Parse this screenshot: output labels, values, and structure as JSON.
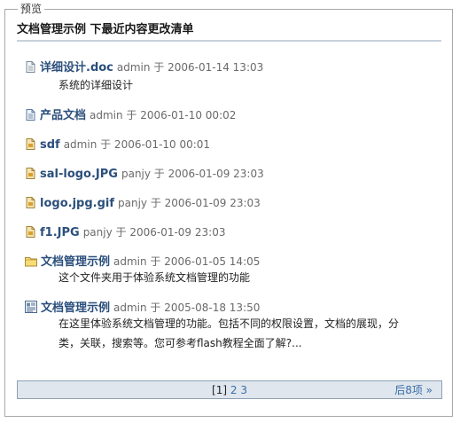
{
  "panel": {
    "legend": "预览"
  },
  "header": {
    "title": "文档管理示例 下最近内容更改清单"
  },
  "items": [
    {
      "icon": "document-icon",
      "name": "详细设计.doc",
      "meta": "admin 于 2006-01-14 13:03",
      "desc": "系统的详细设计"
    },
    {
      "icon": "document-icon",
      "name": "产品文档",
      "meta": "admin 于 2006-01-10 00:02"
    },
    {
      "icon": "image-file-icon",
      "name": "sdf",
      "meta": "admin 于 2006-01-10 00:01"
    },
    {
      "icon": "image-file-icon",
      "name": "sal-logo.JPG",
      "meta": "panjy 于 2006-01-09 23:03"
    },
    {
      "icon": "image-file-icon",
      "name": "logo.jpg.gif",
      "meta": "panjy 于 2006-01-09 23:03"
    },
    {
      "icon": "image-file-icon",
      "name": "f1.JPG",
      "meta": "panjy 于 2006-01-09 23:03"
    },
    {
      "icon": "folder-icon",
      "name": "文档管理示例",
      "meta": "admin 于 2006-01-05 14:05",
      "desc": "这个文件夹用于体验系统文档管理的功能"
    },
    {
      "icon": "news-document-icon",
      "name": "文档管理示例",
      "meta": "admin 于 2005-08-18 13:50",
      "desc_lines": [
        "在这里体验系统文档管理的功能。包括不同的权限设置，文档的展现，分",
        "类，关联，搜索等。您可参考flash教程全面了解?..."
      ]
    }
  ],
  "pager": {
    "current": "[1]",
    "page2": "2",
    "page3": "3",
    "next": "后8项 »"
  },
  "colors": {
    "link": "#2b4f7c",
    "pager_bg": "#dfe6ee",
    "border": "#a8a8a8"
  }
}
